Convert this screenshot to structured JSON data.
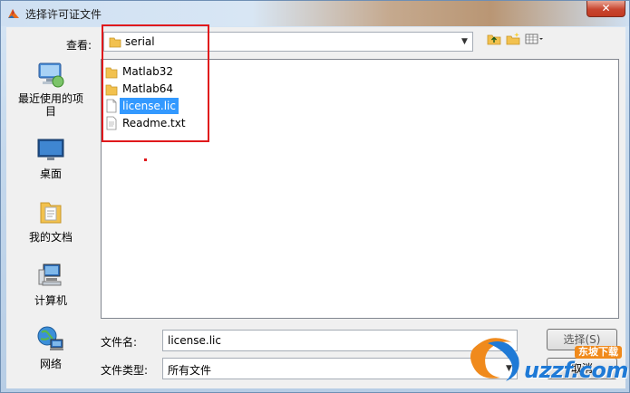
{
  "window": {
    "title": "选择许可证文件",
    "close_label": "✕"
  },
  "lookin": {
    "label": "查看:",
    "folder": "serial"
  },
  "places": [
    {
      "label": "最近使用的项目",
      "icon": "recent-items-icon"
    },
    {
      "label": "桌面",
      "icon": "desktop-icon"
    },
    {
      "label": "我的文档",
      "icon": "documents-icon"
    },
    {
      "label": "计算机",
      "icon": "computer-icon"
    },
    {
      "label": "网络",
      "icon": "network-icon"
    }
  ],
  "files": [
    {
      "name": "Matlab32",
      "type": "folder"
    },
    {
      "name": "Matlab64",
      "type": "folder"
    },
    {
      "name": "license.lic",
      "type": "file",
      "selected": true
    },
    {
      "name": "Readme.txt",
      "type": "file"
    }
  ],
  "filename": {
    "label": "文件名:",
    "value": "license.lic"
  },
  "filetype": {
    "label": "文件类型:",
    "value": "所有文件"
  },
  "buttons": {
    "open": "选择(S)",
    "cancel": "取消"
  },
  "watermark": {
    "text": "uzzf.com",
    "badge": "东坡下载"
  },
  "colors": {
    "highlight": "#e0191c",
    "selection": "#3399ff"
  }
}
